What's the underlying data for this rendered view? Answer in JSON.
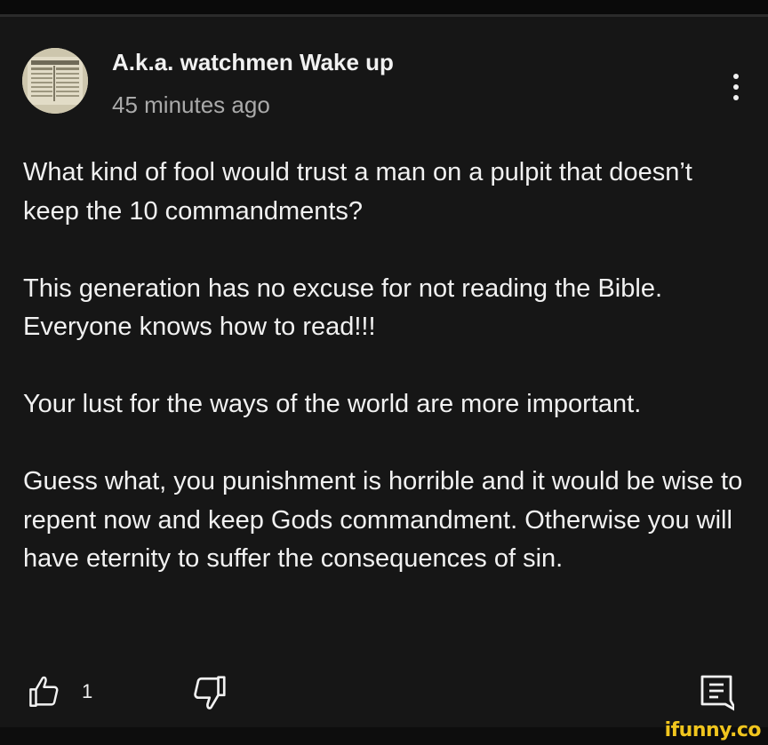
{
  "comment": {
    "author": "A.k.a. watchmen Wake up",
    "timestamp": "45 minutes ago",
    "paragraphs": [
      "What kind of fool would trust a man on a pulpit that doesn’t keep the 10 commandments?",
      "This generation has no excuse for not reading the Bible. Everyone knows how to read!!!",
      "Your lust for the ways of the world are more important.",
      "Guess what, you punishment is horrible and it would be wise to repent now and keep Gods commandment. Otherwise you will have eternity to suffer the consequences of sin."
    ],
    "like_count": "1"
  },
  "icons": {
    "avatar": "avatar-image",
    "more": "three-dots-vertical-icon",
    "like": "thumbs-up-icon",
    "dislike": "thumbs-down-icon",
    "reply": "reply-comment-icon"
  },
  "watermark": "ifunny.co",
  "colors": {
    "background": "#161616",
    "text": "#f1f1f1",
    "secondary_text": "#aaaaaa",
    "watermark": "#f0c51e"
  }
}
